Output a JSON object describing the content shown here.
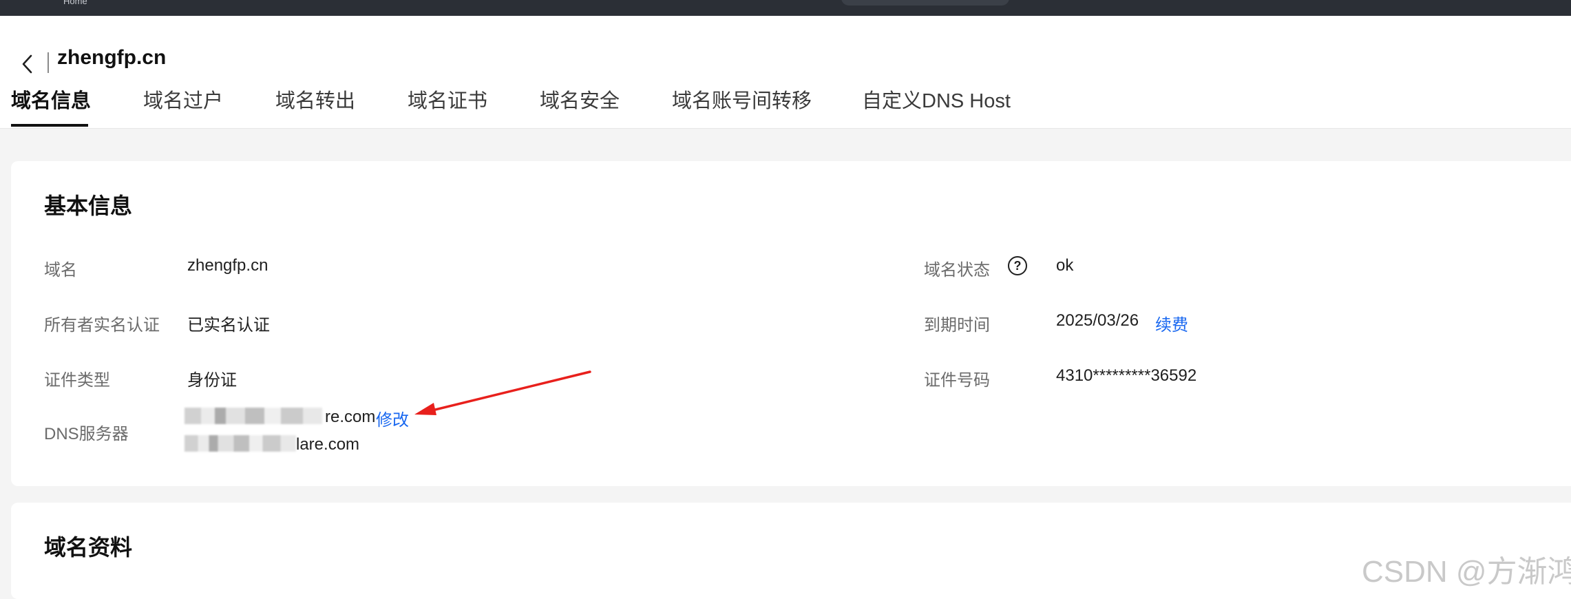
{
  "topbar": {
    "logo_text": "Home"
  },
  "header": {
    "domain": "zhengfp.cn"
  },
  "tabs": [
    {
      "label": "域名信息"
    },
    {
      "label": "域名过户"
    },
    {
      "label": "域名转出"
    },
    {
      "label": "域名证书"
    },
    {
      "label": "域名安全"
    },
    {
      "label": "域名账号间转移"
    },
    {
      "label": "自定义DNS Host"
    }
  ],
  "basic": {
    "title": "基本信息",
    "domain_label": "域名",
    "domain_value": "zhengfp.cn",
    "owner_label": "所有者实名认证",
    "owner_value": "已实名认证",
    "id_type_label": "证件类型",
    "id_type_value": "身份证",
    "dns_label": "DNS服务器",
    "dns_1_visible": "re.com",
    "dns_2_visible": "lare.com",
    "dns_edit_label": "修改",
    "status_label": "域名状态",
    "status_help_icon": "?",
    "status_value": "ok",
    "expiry_label": "到期时间",
    "expiry_value": "2025/03/26",
    "renew_label": "续费",
    "id_number_label": "证件号码",
    "id_number_value": "4310*********36592"
  },
  "profile": {
    "title": "域名资料"
  },
  "watermark": "CSDN @方渐鸿",
  "colors": {
    "link": "#1867f0",
    "arrow": "#e8201c",
    "topbar": "#2b2f36"
  },
  "icons": {
    "back": "chevron-left-icon",
    "help": "question-circle-icon",
    "arrow": "red-arrow-annotation"
  }
}
